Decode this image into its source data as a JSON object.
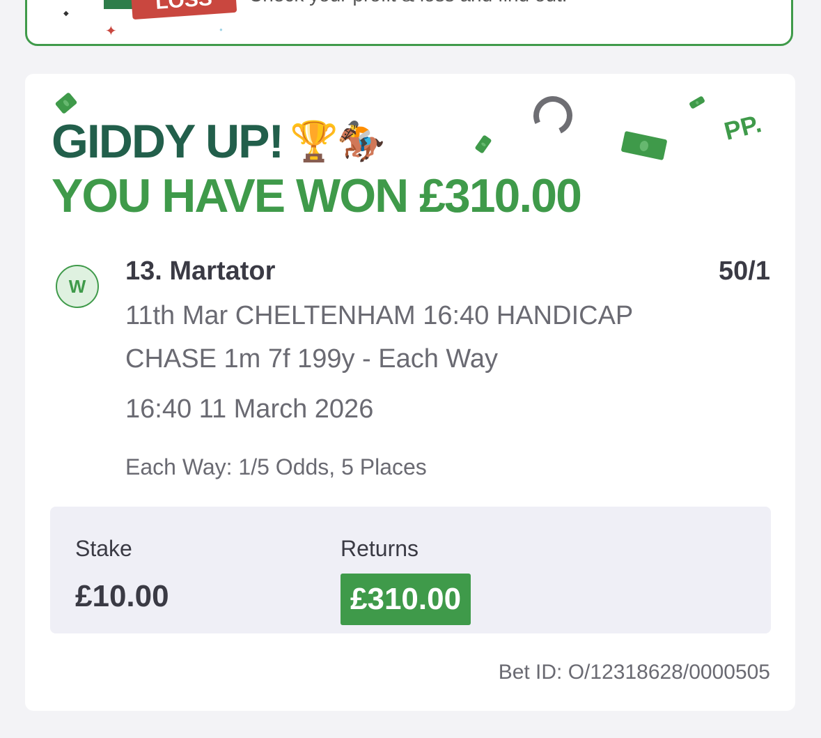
{
  "promo": {
    "badge_text": "LOSS",
    "text": "Check your profit & loss and find out."
  },
  "bet": {
    "headline_1": "GIDDY UP!",
    "headline_emojis": "🏆🏇",
    "headline_2": "YOU HAVE WON £310.00",
    "brand": "PP.",
    "result_badge": "W",
    "runner": "13. Martator",
    "odds": "50/1",
    "market": "11th Mar CHELTENHAM 16:40 HANDICAP CHASE 1m 7f 199y - Each Way",
    "event_time": "16:40 11 March 2026",
    "each_way_terms": "Each Way: 1/5 Odds, 5 Places",
    "stake_label": "Stake",
    "stake_value": "£10.00",
    "returns_label": "Returns",
    "returns_value": "£310.00",
    "bet_id": "Bet ID: O/12318628/0000505"
  },
  "colors": {
    "brand_green": "#3f9a4a",
    "dark_green": "#225f4b",
    "promo_red": "#c9473f"
  }
}
